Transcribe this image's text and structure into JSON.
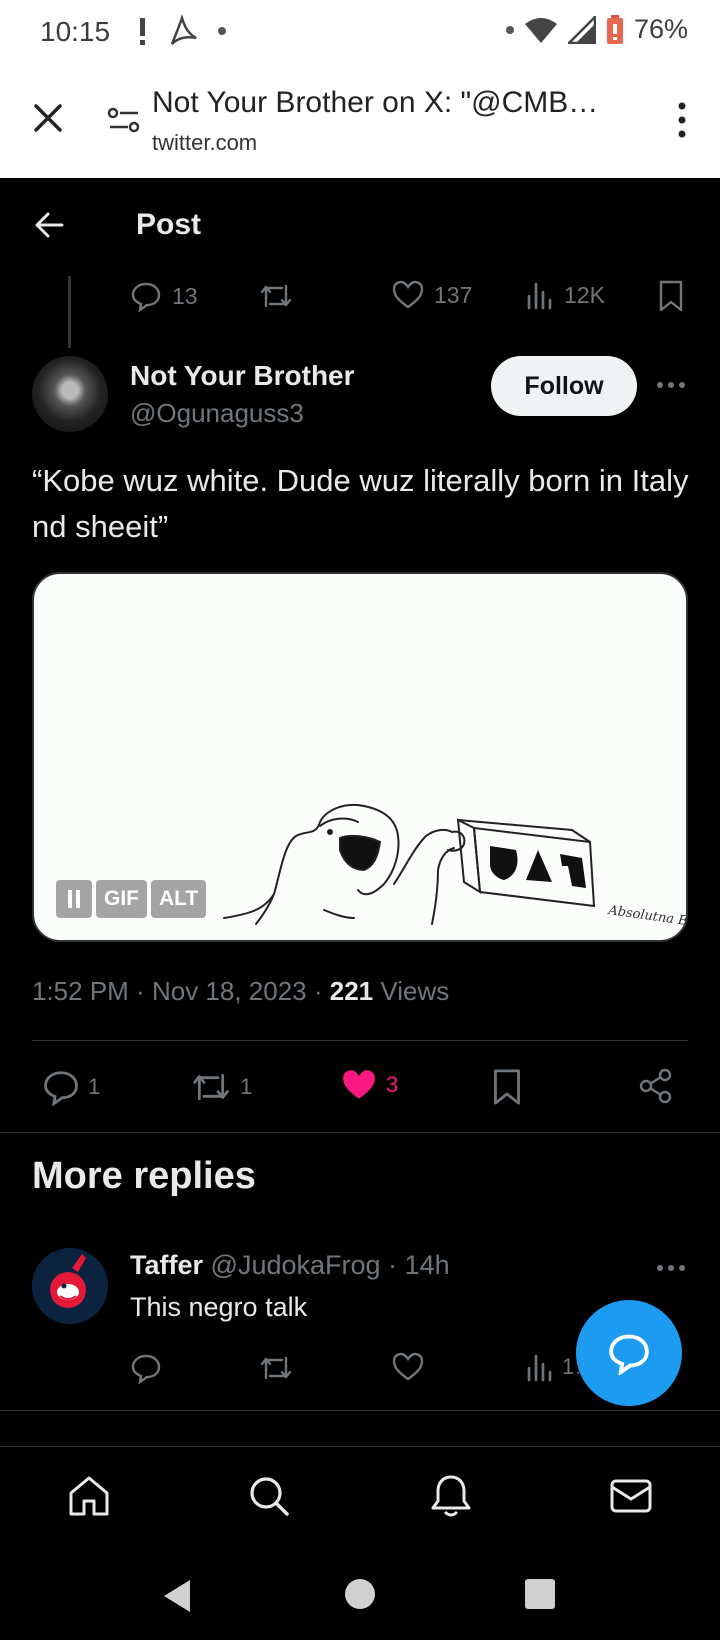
{
  "status_bar": {
    "time": "10:15",
    "battery": "76%",
    "icons": [
      "alert-icon",
      "acrobat-icon",
      "notification-dot",
      "wifi-icon",
      "signal-icon",
      "battery-icon"
    ]
  },
  "browser": {
    "page_title": "Not Your Brother on X: \"@CMB…",
    "url": "twitter.com"
  },
  "header": {
    "title": "Post"
  },
  "parent_stats": {
    "replies": "13",
    "retweets": "",
    "likes": "137",
    "views": "12K"
  },
  "tweet": {
    "author_name": "Not Your Brother",
    "author_handle": "@Ogunaguss3",
    "follow_label": "Follow",
    "text": "“Kobe wuz white. Dude wuz literally born in Italy nd sheeit”",
    "media": {
      "badge_gif": "GIF",
      "badge_alt": "ALT",
      "signature": "Absolutna Ewelina"
    },
    "time": "1:52 PM",
    "date": "Nov 18, 2023",
    "views_count": "221",
    "views_label": "Views",
    "replies": "1",
    "retweets": "1",
    "likes": "3"
  },
  "more_replies": {
    "title": "More replies",
    "reply": {
      "name": "Taffer",
      "handle": "@JudokaFrog",
      "age": "14h",
      "text": "This negro talk",
      "views": "1…"
    }
  },
  "colors": {
    "like_pink": "#f91880",
    "accent_blue": "#1d9bf0",
    "muted": "#71767b"
  }
}
